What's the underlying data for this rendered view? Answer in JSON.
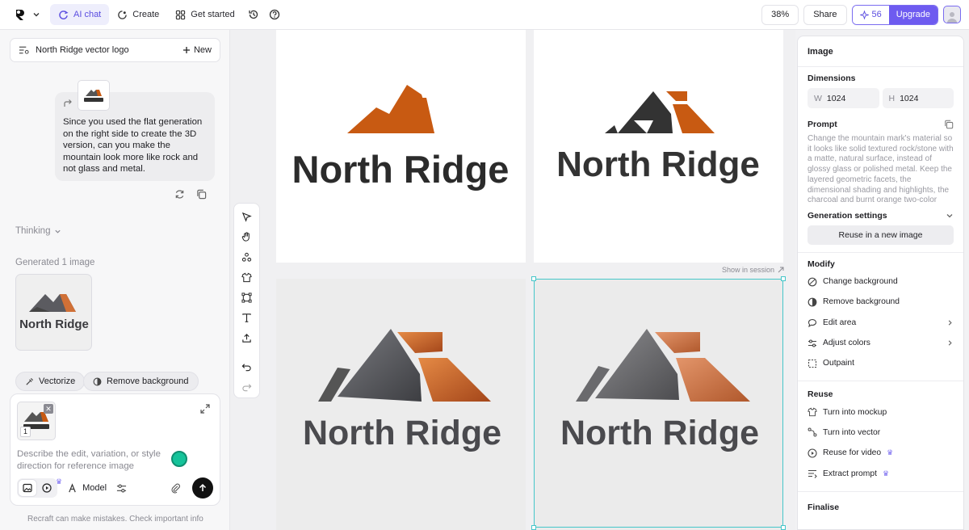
{
  "topbar": {
    "nav": [
      {
        "label": "AI chat",
        "icon": "ai-chat-icon",
        "active": true
      },
      {
        "label": "Create",
        "icon": "create-icon",
        "active": false
      },
      {
        "label": "Get started",
        "icon": "grid-icon",
        "active": false
      }
    ],
    "zoom": "38%",
    "share": "Share",
    "credits": "56",
    "upgrade": "Upgrade"
  },
  "left": {
    "session_title": "North Ridge vector logo",
    "new_label": "New",
    "user_message": "Since you used the flat generation on the right side to create the 3D version, can you make the mountain look more like rock and not glass and metal.",
    "thinking": "Thinking",
    "generated": "Generated 1 image",
    "chips": [
      "Vectorize",
      "Remove background"
    ],
    "composer_placeholder": "Describe the edit, variation, or style direction for reference image",
    "ref_count": "1",
    "model_label": "Model",
    "disclaimer": "Recraft can make mistakes. Check important info"
  },
  "canvas": {
    "logo_text": "North Ridge",
    "show_in_session": "Show in session"
  },
  "right": {
    "header": "Image",
    "dimensions_label": "Dimensions",
    "width_key": "W",
    "width": "1024",
    "height_key": "H",
    "height": "1024",
    "prompt_label": "Prompt",
    "prompt": "Change the mountain mark's material so it looks like solid textured rock/stone with a matte, natural surface, instead of glossy glass or polished metal. Keep the layered geometric facets, the dimensional shading and highlights, the charcoal and burnt orange two-color",
    "gen_settings": "Generation settings",
    "reuse_button": "Reuse in a new image",
    "modify_label": "Modify",
    "modify": [
      {
        "label": "Change background",
        "icon": "change-background-icon",
        "chevron": false
      },
      {
        "label": "Remove background",
        "icon": "remove-background-icon",
        "chevron": false
      },
      {
        "label": "Edit area",
        "icon": "edit-area-icon",
        "chevron": true
      },
      {
        "label": "Adjust colors",
        "icon": "adjust-colors-icon",
        "chevron": true
      },
      {
        "label": "Outpaint",
        "icon": "outpaint-icon",
        "chevron": false
      }
    ],
    "reuse_label": "Reuse",
    "reuse": [
      {
        "label": "Turn into mockup",
        "icon": "mockup-icon",
        "pro": false
      },
      {
        "label": "Turn into vector",
        "icon": "vector-icon",
        "pro": false
      },
      {
        "label": "Reuse for video",
        "icon": "video-icon",
        "pro": true
      },
      {
        "label": "Extract prompt",
        "icon": "extract-prompt-icon",
        "pro": true
      }
    ],
    "finalise_label": "Finalise"
  },
  "colors": {
    "accent": "#6e5bf0",
    "charcoal": "#333333",
    "orange": "#c85a12",
    "selection": "#45c6c9"
  }
}
